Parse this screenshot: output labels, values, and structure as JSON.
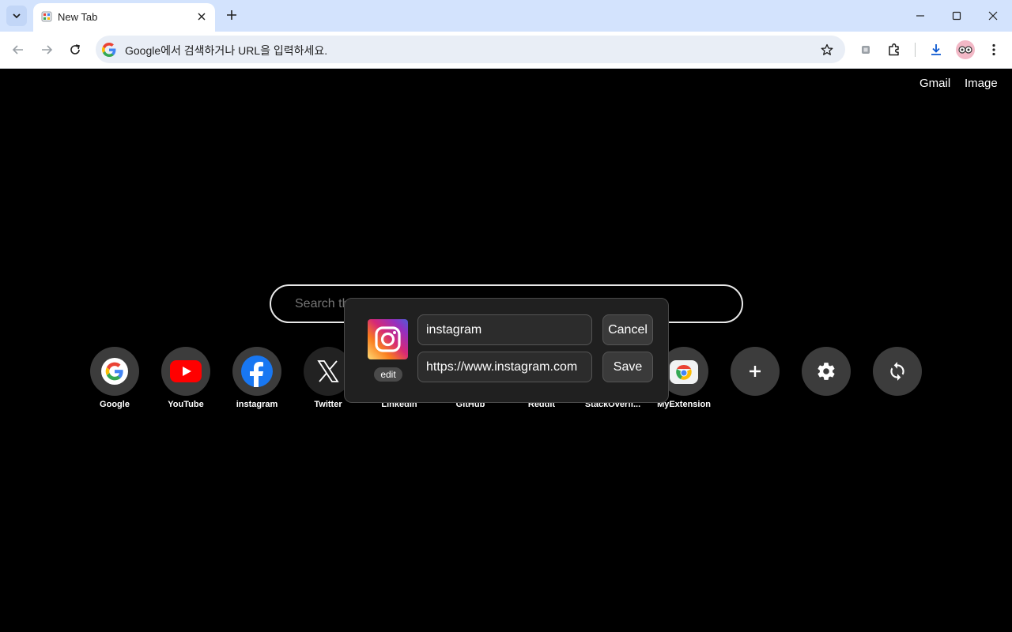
{
  "browser": {
    "tab_title": "New Tab",
    "address_placeholder": "Google에서 검색하거나 URL을 입력하세요."
  },
  "header_links": {
    "gmail": "Gmail",
    "image": "Image"
  },
  "search": {
    "placeholder": "Search th"
  },
  "shortcuts": [
    {
      "label": "Google",
      "icon": "google-icon"
    },
    {
      "label": "YouTube",
      "icon": "youtube-icon"
    },
    {
      "label": "instagram",
      "icon": "facebook-icon"
    },
    {
      "label": "Twitter",
      "icon": "x-icon"
    },
    {
      "label": "LinkedIn",
      "icon": "linkedin-icon"
    },
    {
      "label": "GitHub",
      "icon": "github-icon"
    },
    {
      "label": "Reddit",
      "icon": "reddit-icon"
    },
    {
      "label": "StackOverfl...",
      "icon": "stackoverflow-icon"
    },
    {
      "label": "MyExtension",
      "icon": "chrome-icon"
    }
  ],
  "actions": [
    {
      "icon": "plus-icon"
    },
    {
      "icon": "gear-icon"
    },
    {
      "icon": "refresh-icon"
    }
  ],
  "edit_popup": {
    "edit_label": "edit",
    "name_value": "instagram",
    "url_value": "https://www.instagram.com",
    "cancel_label": "Cancel",
    "save_label": "Save"
  },
  "colors": {
    "tabstrip_bg": "#d3e3fd",
    "page_bg": "#000000",
    "popup_bg": "#202020",
    "shortcut_circle": "#3c3c3c"
  }
}
